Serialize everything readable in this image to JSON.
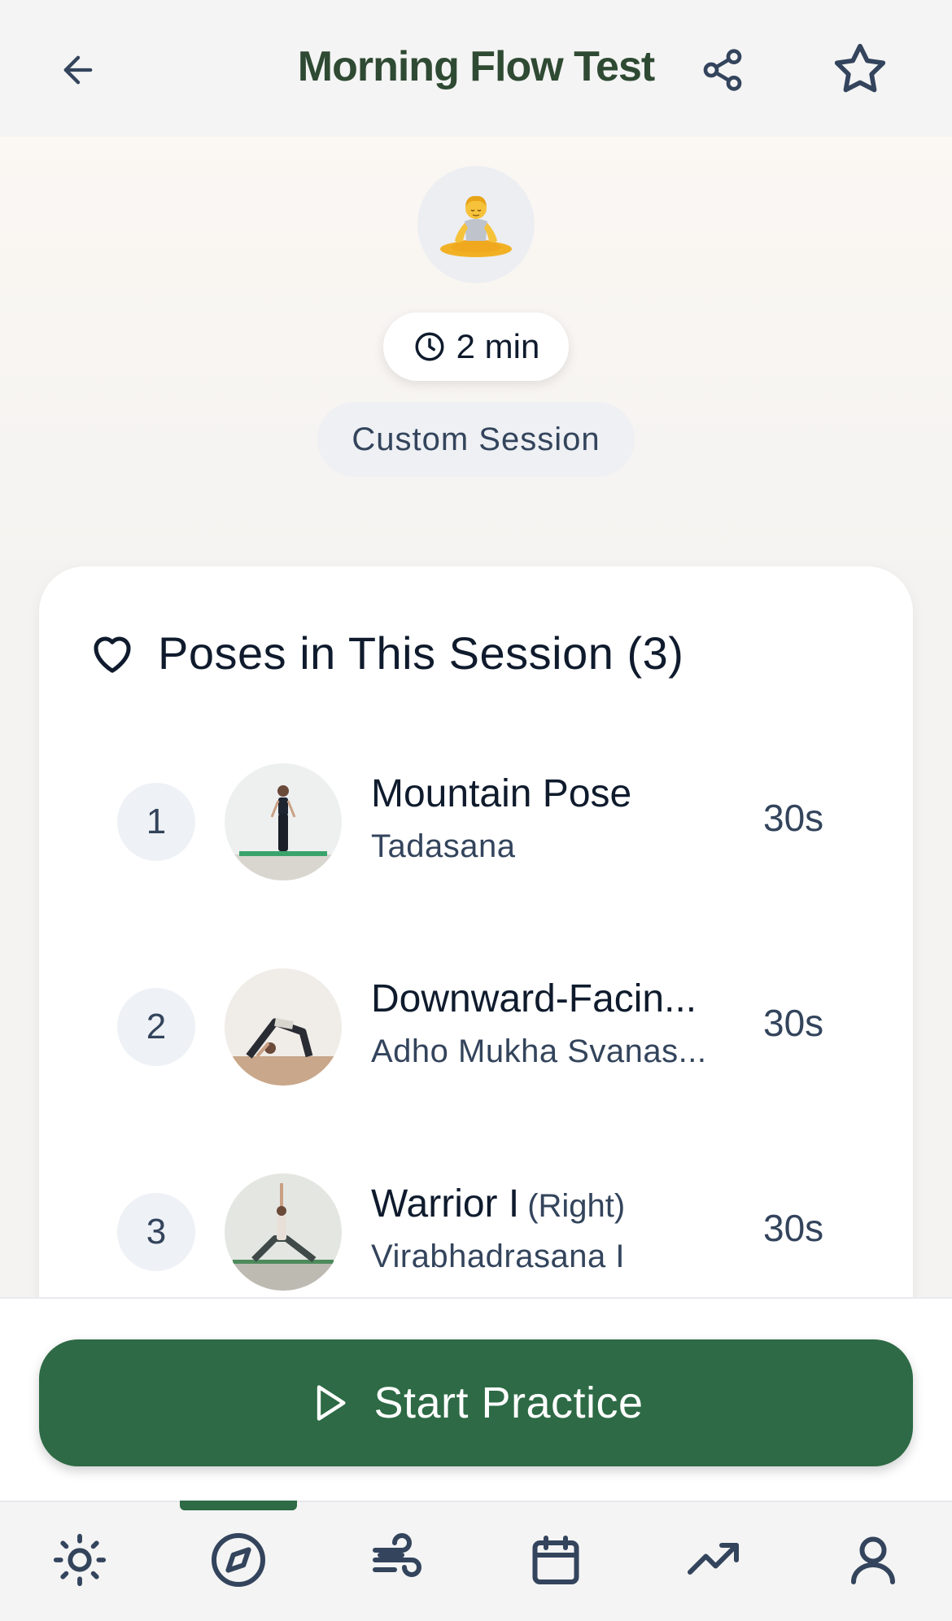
{
  "header": {
    "title": "Morning Flow Test",
    "back_icon": "arrow-left-icon",
    "share_icon": "share-icon",
    "favorite_icon": "star-icon"
  },
  "hero": {
    "emoji": "🧘",
    "duration": "2 min",
    "duration_icon": "clock-icon",
    "session_type": "Custom Session"
  },
  "poses_card": {
    "heading": "Poses in This Session (3)",
    "heading_icon": "heart-icon",
    "poses": [
      {
        "number": "1",
        "name": "Mountain Pose",
        "side": "",
        "sanskrit": "Tadasana",
        "duration": "30s"
      },
      {
        "number": "2",
        "name": "Downward-Facin...",
        "side": "",
        "sanskrit": "Adho Mukha Svanas...",
        "duration": "30s"
      },
      {
        "number": "3",
        "name": "Warrior I",
        "side": "(Right)",
        "sanskrit": "Virabhadrasana I",
        "duration": "30s"
      }
    ]
  },
  "action": {
    "start_label": "Start Practice",
    "start_icon": "play-icon"
  },
  "tabbar": {
    "active_index": 1,
    "tabs": [
      {
        "icon": "sun-icon"
      },
      {
        "icon": "compass-icon"
      },
      {
        "icon": "wind-icon"
      },
      {
        "icon": "calendar-icon"
      },
      {
        "icon": "trending-up-icon"
      },
      {
        "icon": "user-icon"
      }
    ]
  },
  "colors": {
    "brand_green": "#2d6a45",
    "title_green": "#2f4a33",
    "text_dark": "#0f1b2d",
    "text_muted": "#33445c"
  }
}
